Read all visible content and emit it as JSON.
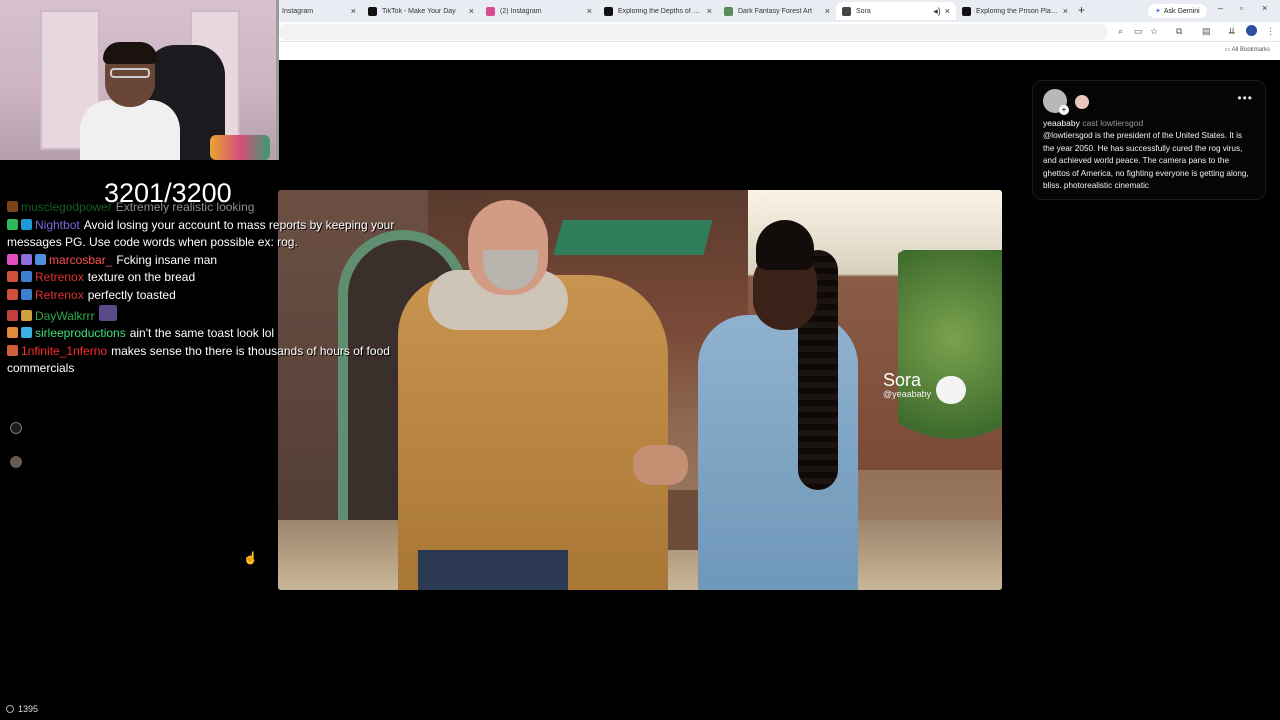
{
  "browser": {
    "tabs": [
      {
        "title": "Instagram",
        "favicon_color": "#d9498f"
      },
      {
        "title": "TikTok - Make Your Day",
        "favicon_color": "#111111"
      },
      {
        "title": "(2) Instagram",
        "favicon_color": "#d9498f"
      },
      {
        "title": "Exploring the Depths of Dark F...",
        "favicon_color": "#111111"
      },
      {
        "title": "Dark Fantasy Forest Art",
        "favicon_color": "#5b8a5b"
      },
      {
        "title": "Sora",
        "favicon_color": "#444444"
      },
      {
        "title": "Exploring the Prison Planet The...",
        "favicon_color": "#111111"
      }
    ],
    "active_tab_index": 5,
    "ask_gemini_label": "Ask Gemini",
    "all_bookmarks_label": "All Bookmarks"
  },
  "stream": {
    "counter": "3201/3200",
    "viewer_count": "1395"
  },
  "chat": {
    "messages": [
      {
        "user": "musclegodpower",
        "color": "#2ba84a",
        "badges": [
          "#e07a2a"
        ],
        "text": "Extremely realistic looking"
      },
      {
        "user": "Nightbot",
        "color": "#7b67d8",
        "badges": [
          "#2eb85c",
          "#1e9bd7"
        ],
        "text": "Avoid losing your account to mass reports by keeping your messages PG. Use code words when possible ex: rog."
      },
      {
        "user": "marcosbar_",
        "color": "#ff4f4f",
        "badges": [
          "#e24fbf",
          "#8d6fe0",
          "#4f8fe0"
        ],
        "text": "Fcking insane man"
      },
      {
        "user": "Retrenox",
        "color": "#e0332f",
        "badges": [
          "#d0503c",
          "#3c7fd0"
        ],
        "text": "texture on the bread"
      },
      {
        "user": "Retrenox",
        "color": "#e0332f",
        "badges": [
          "#d0503c",
          "#3c7fd0"
        ],
        "text": "perfectly toasted"
      },
      {
        "user": "DayWalkrrr",
        "color": "#2ea84a",
        "badges": [
          "#c0403c",
          "#d0a03c"
        ],
        "text": ""
      },
      {
        "user": "sirleeproductions",
        "color": "#3ee07a",
        "badges": [
          "#e08a3c",
          "#3cb0e0"
        ],
        "text": "ain't the same toast look lol"
      },
      {
        "user": "1nfinite_1nferno",
        "color": "#ff2a2a",
        "badges": [
          "#d0603c"
        ],
        "text": "makes sense tho there is thousands of hours of food commercials"
      }
    ]
  },
  "video": {
    "watermark_title": "Sora",
    "watermark_handle": "@yeaababy"
  },
  "post": {
    "username": "yeaababy",
    "cast_text": "cast lowtiersgod",
    "body": "@lowtiersgod is the president of the United States. It is the year 2050. He has successfully cured the rog virus, and achieved world peace. The camera pans to the ghettos of America, no fighting everyone is getting along, bliss. photorealistic cinematic"
  }
}
